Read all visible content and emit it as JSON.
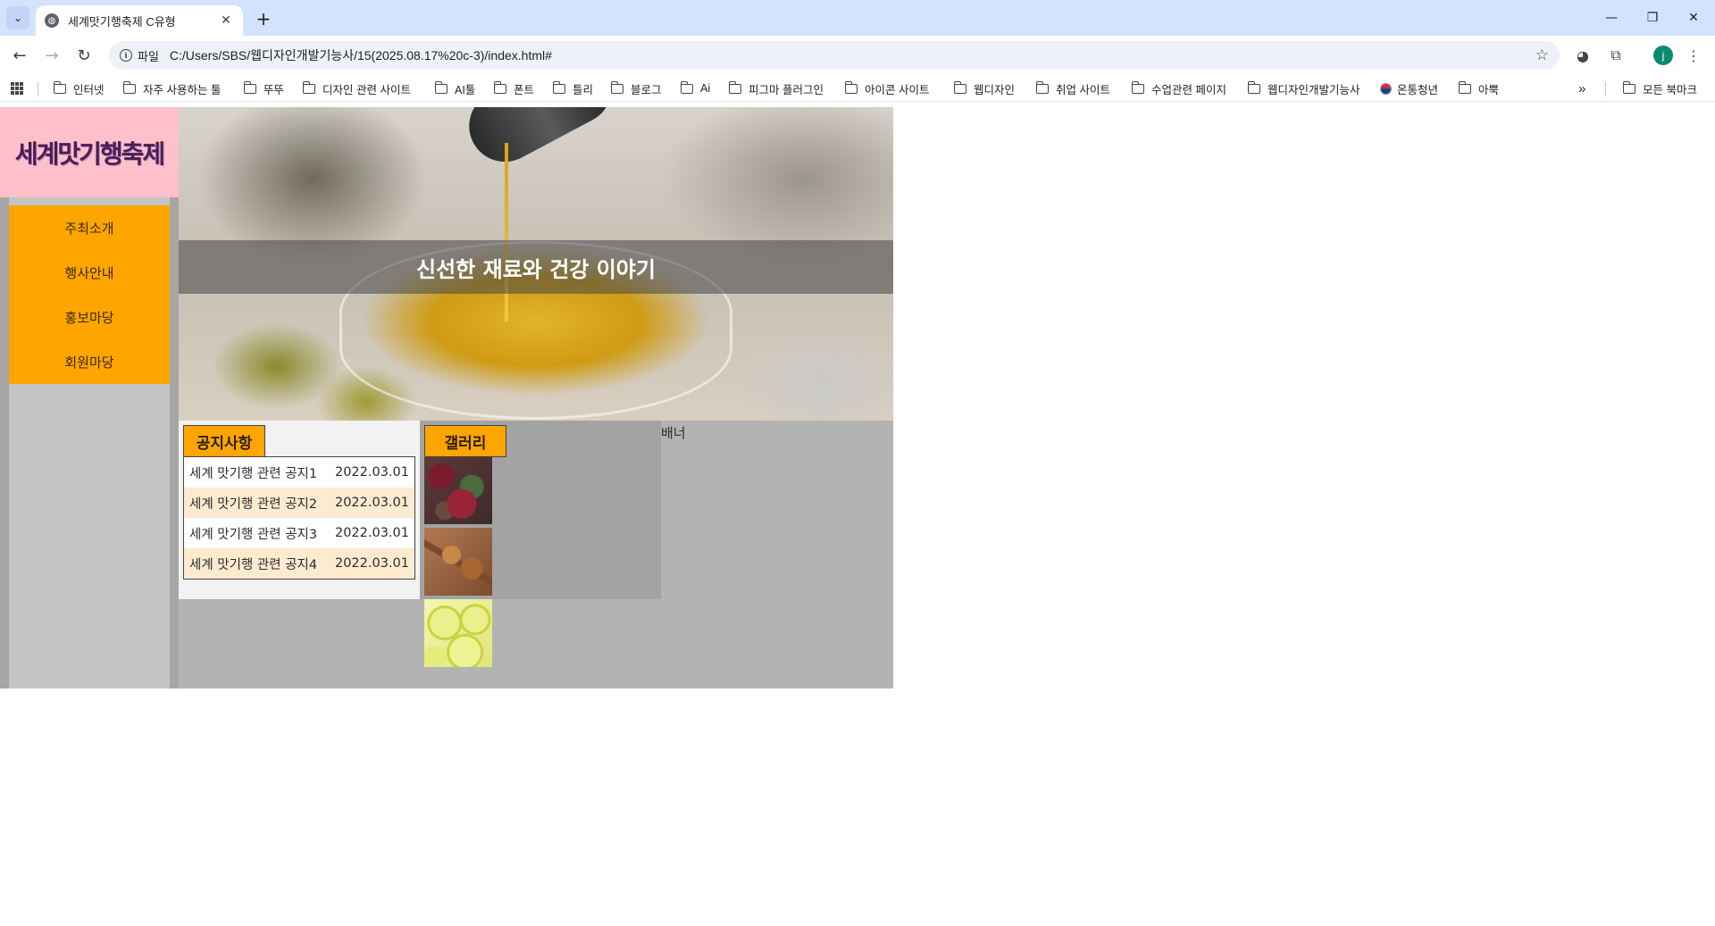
{
  "browser": {
    "tab_title": "세계맛기행축제 C유형",
    "new_tab_icon": "+",
    "url_chip": "파일",
    "url": "C:/Users/SBS/웹디자인개발기능사/15(2025.08.17%20c-3)/index.html#",
    "profile_initial": "j",
    "bookmarks": [
      {
        "label": "인터넷",
        "icon": "folder-icon"
      },
      {
        "label": "자주 사용하는 툴",
        "icon": "folder-icon"
      },
      {
        "label": "뚜뚜",
        "icon": "folder-icon"
      },
      {
        "label": "디자인 관련 사이트",
        "icon": "folder-icon"
      },
      {
        "label": "AI툴",
        "icon": "folder-icon"
      },
      {
        "label": "폰트",
        "icon": "folder-icon"
      },
      {
        "label": "틀리",
        "icon": "folder-icon"
      },
      {
        "label": "블로그",
        "icon": "folder-icon"
      },
      {
        "label": "Ai",
        "icon": "folder-icon"
      },
      {
        "label": "피그마 플러그인",
        "icon": "folder-icon"
      },
      {
        "label": "아이콘 사이트",
        "icon": "folder-icon"
      },
      {
        "label": "웹디자인",
        "icon": "folder-icon"
      },
      {
        "label": "취업 사이트",
        "icon": "folder-icon"
      },
      {
        "label": "수업관련 페이지",
        "icon": "folder-icon"
      },
      {
        "label": "웹디자인개발기능사",
        "icon": "folder-icon"
      },
      {
        "label": "온통청년",
        "icon": "flag-icon"
      },
      {
        "label": "아뿍",
        "icon": "folder-icon"
      }
    ],
    "overflow_label": "»",
    "all_bookmarks": "모든 북마크"
  },
  "site": {
    "logo": "세계맛기행축제",
    "menu": [
      "주최소개",
      "행사안내",
      "홍보마당",
      "회원마당"
    ],
    "hero_text": "신선한 재료와 건강 이야기",
    "notice": {
      "title": "공지사항",
      "items": [
        {
          "title": "세계 맛기행 관련 공지1",
          "date": "2022.03.01"
        },
        {
          "title": "세계 맛기행 관련 공지2",
          "date": "2022.03.01"
        },
        {
          "title": "세계 맛기행 관련 공지3",
          "date": "2022.03.01"
        },
        {
          "title": "세계 맛기행 관련 공지4",
          "date": "2022.03.01"
        }
      ]
    },
    "gallery": {
      "title": "갤러리",
      "images": [
        "spices-image",
        "cinnamon-image",
        "lime-image"
      ]
    },
    "banner_label": "배너"
  },
  "colors": {
    "logo_bg": "#ffc0cb",
    "menu_bg": "#ffa500",
    "tab_label_bg": "#ffa500",
    "notice_alt_row": "#fdebd0"
  }
}
